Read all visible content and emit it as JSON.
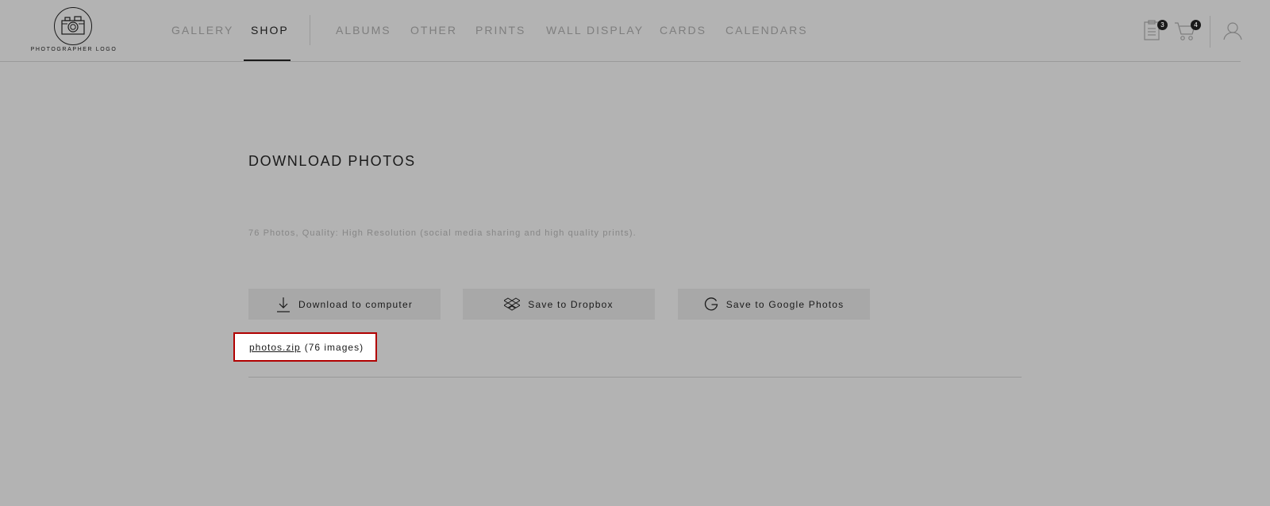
{
  "header": {
    "logo_text": "PHOTOGRAPHER LOGO",
    "nav": [
      {
        "label": "GALLERY",
        "active": false
      },
      {
        "label": "SHOP",
        "active": true
      },
      {
        "label": "ALBUMS",
        "active": false
      },
      {
        "label": "OTHER",
        "active": false
      },
      {
        "label": "PRINTS",
        "active": false
      },
      {
        "label": "WALL DISPLAY",
        "active": false
      },
      {
        "label": "CARDS",
        "active": false
      },
      {
        "label": "CALENDARS",
        "active": false
      }
    ],
    "orders_badge": "3",
    "cart_badge": "4",
    "icons": {
      "logo": "camera-icon",
      "orders": "clipboard-list-icon",
      "cart": "shopping-cart-icon",
      "account": "user-icon"
    }
  },
  "main": {
    "title": "DOWNLOAD PHOTOS",
    "info": "76 Photos, Quality: High Resolution (social media sharing and high quality prints).",
    "buttons": [
      {
        "label": "Download to computer",
        "icon": "download-icon"
      },
      {
        "label": "Save to Dropbox",
        "icon": "dropbox-icon"
      },
      {
        "label": "Save to Google Photos",
        "icon": "google-icon"
      }
    ],
    "file": {
      "name": "photos.zip",
      "count": "(76 images)"
    }
  },
  "colors": {
    "overlay_background": "#b3b3b3",
    "text_dark": "#1a1a1a",
    "text_muted": "#7e7e7e",
    "highlight_border": "#b00000"
  }
}
